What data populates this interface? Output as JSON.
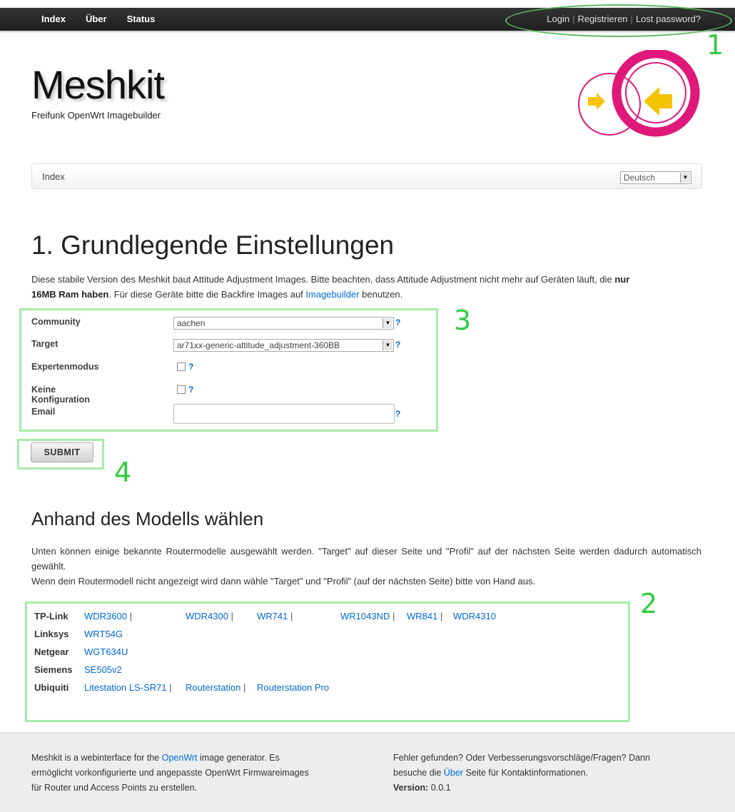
{
  "topbar": {
    "nav": [
      "Index",
      "Über",
      "Status"
    ],
    "auth": {
      "login": "Login",
      "register": "Registrieren",
      "lost": "Lost password?"
    }
  },
  "brand": {
    "title": "Meshkit",
    "subtitle": "Freifunk OpenWrt Imagebuilder"
  },
  "breadcrumb": {
    "current": "Index",
    "language": "Deutsch"
  },
  "main": {
    "title": "1. Grundlegende Einstellungen",
    "intro_1": "Diese stabile Version des Meshkit baut Attitude Adjustment Images. Bitte beachten, dass Attitude Adjustment nicht mehr auf Geräten läuft, die ",
    "intro_bold_1": "nur",
    "intro_bold_2": "16MB Ram haben",
    "intro_2": ". Für diese Geräte bitte die Backfire Images auf ",
    "intro_link": "Imagebuilder",
    "intro_3": " benutzen."
  },
  "form": {
    "community_label": "Community",
    "community_value": "aachen",
    "target_label": "Target",
    "target_value": "ar71xx-generic-attitude_adjustment-360BB",
    "expert_label": "Expertenmodus",
    "noconfig_label": "Keine Konfiguration",
    "email_label": "Email",
    "email_value": "",
    "help": "?",
    "submit": "SUBMIT"
  },
  "models": {
    "title": "Anhand des Modells wählen",
    "desc_1": "Unten können einige bekannte Routermodelle ausgewählt werden. \"Target\" auf dieser Seite und \"Profil\" auf der nächsten Seite werden dadurch automatisch gewählt.",
    "desc_2": "Wenn dein Routermodell nicht angezeigt wird dann wähle \"Target\" und \"Profil\" (auf der nächsten Seite) bitte von Hand aus.",
    "rows": [
      {
        "vendor": "TP-Link",
        "items": [
          "WDR3600",
          "WDR4300",
          "WR741",
          "WR1043ND",
          "WR841",
          "WDR4310"
        ]
      },
      {
        "vendor": "Linksys",
        "items": [
          "WRT54G"
        ]
      },
      {
        "vendor": "Netgear",
        "items": [
          "WGT634U"
        ]
      },
      {
        "vendor": "Siemens",
        "items": [
          "SE505v2"
        ]
      },
      {
        "vendor": "Ubiquiti",
        "items": [
          "Litestation LS-SR71",
          "Routerstation",
          "Routerstation Pro"
        ]
      }
    ]
  },
  "annotations": [
    "1",
    "2",
    "3",
    "4"
  ],
  "footer": {
    "left_1": "Meshkit is a webinterface for the ",
    "left_link": "OpenWrt",
    "left_2": " image generator. Es",
    "left_3": "ermöglicht vorkonfigurierte und angepasste OpenWrt Firmwareimages",
    "left_4": "für Router und Access Points zu erstellen.",
    "right_1": "Fehler gefunden? Oder Verbesserungsvorschläge/Fragen? Dann",
    "right_2a": "besuche die ",
    "right_link": "Über",
    "right_2b": " Seite für Kontaktinformationen.",
    "version_label": "Version:",
    "version_value": " 0.0.1"
  },
  "colors": {
    "accent": "#0069d6",
    "annotation": "#2ecc40",
    "logo": "#e0187a",
    "arrow": "#f5c400"
  }
}
